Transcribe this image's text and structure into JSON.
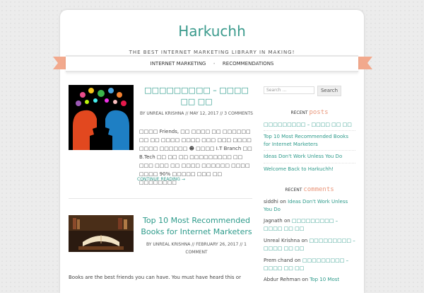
{
  "site": {
    "title": "Harkuchh",
    "tagline": "THE BEST INTERNET MARKETING LIBRARY IN MAKING!"
  },
  "nav": {
    "items": [
      "INTERNET MARKETING",
      "RECOMMENDATIONS"
    ]
  },
  "posts": [
    {
      "title": "□□□□□□□□□ – □□□□ □□ □□",
      "meta": "BY UNREAL KRISHNA // MAY 12, 2017 // 3 COMMENTS",
      "excerpt": "□□□□ Friends, □□ □□□□ □□ □□□□□□ □□ □□ □□□□ □□□□ □□□ □□□ □□□□ □□□□ □□□□□□ ☻ □□□□ I.T Branch □□ B.Tech □□ □□ □□ □□□□□□□□□ □□ □□□ □□□ □□ □□□□ □□□□□□ □□□□ □□□□ 90% □□□□□ □□□ □□ □□□□□□□□",
      "more": "CONTINUE READING →"
    },
    {
      "title": "Top 10 Most Recommended Books for Internet Marketers",
      "meta": "BY UNREAL KRISHNA // FEBRUARY 26, 2017 // 1 COMMENT",
      "excerpt": "Books are the best friends you can have. You must have heard this or"
    }
  ],
  "sidebar": {
    "search_placeholder": "Search …",
    "search_button": "Search",
    "recent_posts": {
      "label": "RECENT",
      "highlight": "posts",
      "items": [
        "□□□□□□□□□ – □□□□ □□ □□",
        "Top 10 Most Recommended Books for Internet Marketers",
        "Ideas Don't Work Unless You Do",
        "Welcome Back to Harkuchh!"
      ]
    },
    "recent_comments": {
      "label": "RECENT",
      "highlight": "comments",
      "items": [
        {
          "author": "siddhi",
          "on": "on",
          "post": "Ideas Don't Work Unless You Do"
        },
        {
          "author": "Jagnath",
          "on": "on",
          "post": "□□□□□□□□□ – □□□□ □□ □□"
        },
        {
          "author": "Unreal Krishna",
          "on": "on",
          "post": "□□□□□□□□□ – □□□□ □□ □□"
        },
        {
          "author": "Prem chand",
          "on": "on",
          "post": "□□□□□□□□□ – □□□□ □□ □□"
        },
        {
          "author": "Abdur Rehman",
          "on": "on",
          "post": "Top 10 Most"
        }
      ]
    }
  },
  "colors": {
    "accent": "#2c9a8a",
    "ribbon": "#f2a98d",
    "highlight": "#e9967a"
  }
}
